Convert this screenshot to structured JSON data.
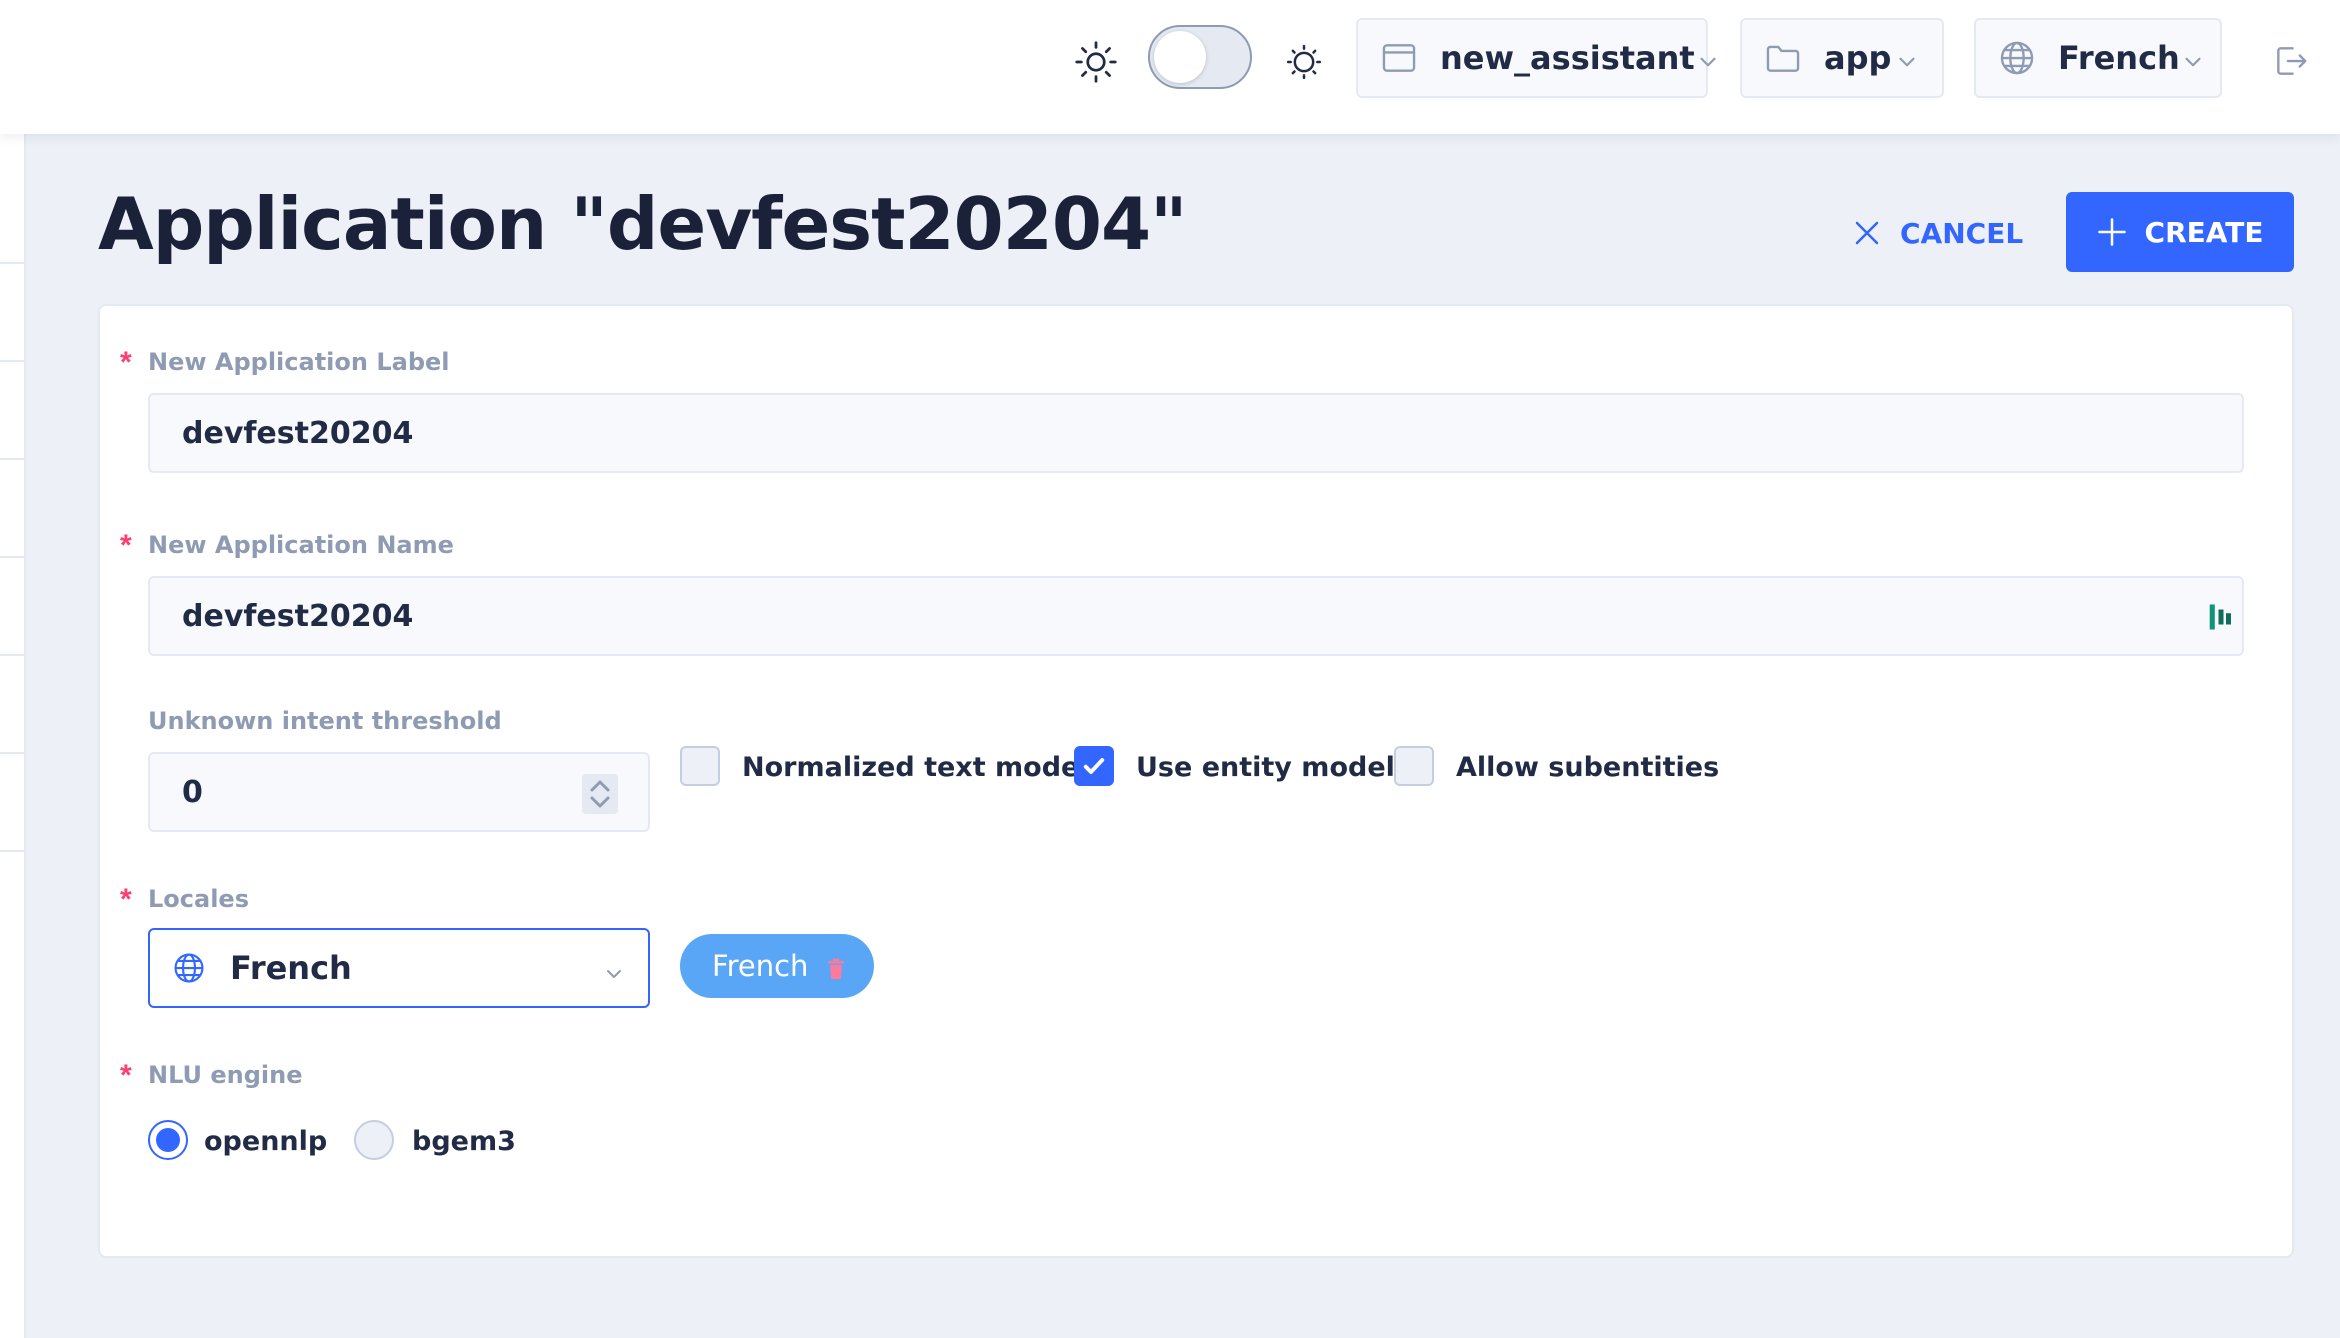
{
  "header": {
    "theme_toggle_on": false,
    "selectors": {
      "namespace": "new_assistant",
      "application": "app",
      "locale": "French"
    }
  },
  "page": {
    "title": "Application \"devfest20204\"",
    "cancel_label": "CANCEL",
    "create_label": "CREATE"
  },
  "form": {
    "label_field": {
      "label": "New Application Label",
      "required": "*",
      "value": "devfest20204"
    },
    "name_field": {
      "label": "New Application Name",
      "required": "*",
      "value": "devfest20204"
    },
    "threshold": {
      "label": "Unknown intent threshold",
      "value": "0"
    },
    "options": [
      {
        "label": "Normalized text models",
        "checked": false
      },
      {
        "label": "Use entity models",
        "checked": true
      },
      {
        "label": "Allow subentities",
        "checked": false
      }
    ],
    "locales": {
      "label": "Locales",
      "required": "*",
      "selected": "French",
      "tags": [
        "French"
      ]
    },
    "nlu_engine": {
      "label": "NLU engine",
      "required": "*",
      "options": [
        {
          "label": "opennlp",
          "selected": true
        },
        {
          "label": "bgem3",
          "selected": false
        }
      ]
    }
  },
  "colors": {
    "primary": "#3366ff",
    "required": "#ff3d71",
    "tag": "#5aa6f6",
    "label": "#8f9bb3"
  }
}
